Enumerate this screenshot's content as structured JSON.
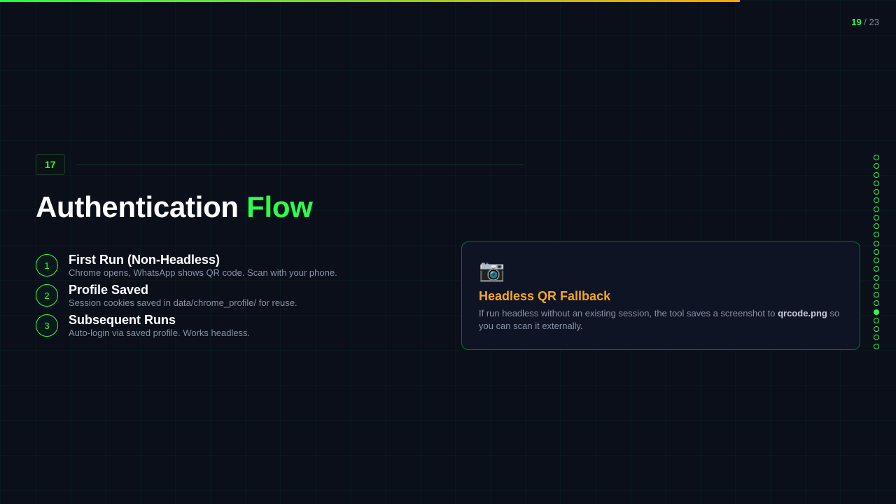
{
  "progress": {
    "fraction": 0.826
  },
  "counter": {
    "current": "19",
    "separator": " / ",
    "total": "23"
  },
  "slide": {
    "number": "17",
    "title_main": "Authentication ",
    "title_accent": "Flow"
  },
  "steps": [
    {
      "num": "1",
      "title": "First Run (Non-Headless)",
      "desc": "Chrome opens, WhatsApp shows QR code. Scan with your phone."
    },
    {
      "num": "2",
      "title": "Profile Saved",
      "desc": "Session cookies saved in data/chrome_profile/ for reuse."
    },
    {
      "num": "3",
      "title": "Subsequent Runs",
      "desc": "Auto-login via saved profile. Works headless."
    }
  ],
  "card": {
    "icon": "camera-icon",
    "icon_glyph": "📷",
    "title": "Headless QR Fallback",
    "body_before": "If run headless without an existing session, the tool saves a screenshot to ",
    "body_bold": "qrcode.png",
    "body_after": " so you can scan it externally."
  },
  "nav": {
    "dot_count": 23,
    "active_index": 18
  },
  "colors": {
    "accent": "#2bff4a",
    "warning": "#f5a623",
    "background": "#0a0f1a"
  }
}
